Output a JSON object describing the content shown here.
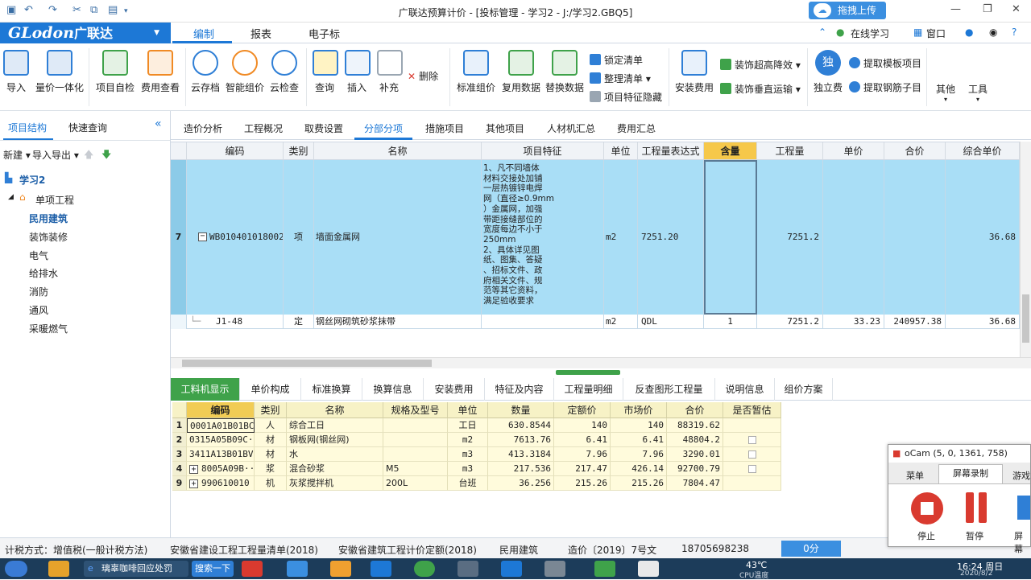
{
  "titlebar": {
    "title": "广联达预算计价 - [投标管理 - 学习2 - J:/学习2.GBQ5]",
    "upload": "拖拽上传",
    "min": "—",
    "restore": "❐",
    "close": "✕"
  },
  "menubar": {
    "logo": "GLodon",
    "logo_cn": "广联达",
    "tabs": [
      "编制",
      "报表",
      "电子标"
    ],
    "right": [
      "在线学习",
      "窗口",
      "?"
    ]
  },
  "ribbon": {
    "big": [
      "导入",
      "量价一体化",
      "项目自检",
      "费用查看",
      "云存档",
      "智能组价",
      "云检查",
      "查询",
      "插入",
      "补充",
      "标准组价",
      "复用数据",
      "替换数据",
      "安装费用",
      "独立费",
      "其他",
      "工具"
    ],
    "small": {
      "delete": "删除",
      "lock": "锁定清单",
      "tidy": "整理清单",
      "hide": "项目特征隐藏",
      "deco_height": "装饰超高降效",
      "deco_vertical": "装饰垂直运输",
      "template": "提取模板项目",
      "rebar": "提取钢筋子目"
    },
    "colors": {
      "blue": "#2f7fd6",
      "orange": "#f08a24",
      "green": "#3fa24a",
      "red": "#d93a2f"
    }
  },
  "left": {
    "tabs": [
      "项目结构",
      "快速查询"
    ],
    "toolbar": [
      "新建",
      "导入导出"
    ],
    "tree": {
      "root": "学习2",
      "unit": "单项工程",
      "items": [
        "民用建筑",
        "装饰装修",
        "电气",
        "给排水",
        "消防",
        "通风",
        "采暖燃气"
      ]
    }
  },
  "main": {
    "tabs": [
      "造价分析",
      "工程概况",
      "取费设置",
      "分部分项",
      "措施项目",
      "其他项目",
      "人材机汇总",
      "费用汇总"
    ],
    "headers": [
      "编码",
      "类别",
      "名称",
      "项目特征",
      "单位",
      "工程量表达式",
      "含量",
      "工程量",
      "单价",
      "合价",
      "综合单价"
    ],
    "row7": {
      "num": "7",
      "code": "WB010401018002",
      "type": "项",
      "name": "墙面金属网",
      "feature": [
        "1、凡不同墙体",
        "材料交接处加铺",
        "一层热镀锌电焊",
        "网（直径≥0.9mm",
        "）金属网，加强",
        "带距接缝部位的",
        "宽度每边不小于",
        "250mm",
        "2、具体详见图",
        "纸、图集、答疑",
        "、招标文件、政",
        "府相关文件、规",
        "范等其它资料，",
        "满足验收要求"
      ],
      "unit": "m2",
      "expr": "7251.20",
      "qty": "7251.2",
      "unit_price": "",
      "total": "",
      "composite": "36.68"
    },
    "sub": {
      "code": "J1-48",
      "type": "定",
      "name": "钢丝网砌筑砂浆抹带",
      "unit": "m2",
      "expr": "QDL",
      "content": "1",
      "qty": "7251.2",
      "unit_price": "33.23",
      "total": "240957.38",
      "composite": "36.68"
    }
  },
  "bottom": {
    "tabs": [
      "工料机显示",
      "单价构成",
      "标准换算",
      "换算信息",
      "安装费用",
      "特征及内容",
      "工程量明细",
      "反查图形工程量",
      "说明信息",
      "组价方案"
    ],
    "headers": [
      "编码",
      "类别",
      "名称",
      "规格及型号",
      "单位",
      "数量",
      "定额价",
      "市场价",
      "合价",
      "是否暂估"
    ],
    "rows": [
      {
        "n": "1",
        "code": "0001A01B01BC",
        "type": "人",
        "name": "综合工日",
        "spec": "",
        "unit": "工日",
        "qty": "630.8544",
        "quota": "140",
        "market": "140",
        "total": "88319.62",
        "est": ""
      },
      {
        "n": "2",
        "code": "0315A05B09C···",
        "type": "材",
        "name": "钢板网(钢丝网)",
        "spec": "",
        "unit": "m2",
        "qty": "7613.76",
        "quota": "6.41",
        "market": "6.41",
        "total": "48804.2",
        "est": "box"
      },
      {
        "n": "3",
        "code": "3411A13B01BV",
        "type": "材",
        "name": "水",
        "spec": "",
        "unit": "m3",
        "qty": "413.3184",
        "quota": "7.96",
        "market": "7.96",
        "total": "3290.01",
        "est": "box"
      },
      {
        "n": "4",
        "code": "8005A09B···",
        "type": "浆",
        "name": "混合砂浆",
        "spec": "M5",
        "unit": "m3",
        "qty": "217.536",
        "quota": "217.47",
        "market": "426.14",
        "total": "92700.79",
        "est": "box"
      },
      {
        "n": "9",
        "code": "990610010",
        "type": "机",
        "name": "灰浆搅拌机",
        "spec": "200L",
        "unit": "台班",
        "qty": "36.256",
        "quota": "215.26",
        "market": "215.26",
        "total": "7804.47",
        "est": ""
      }
    ]
  },
  "status": [
    "计税方式：增值税(一般计税方法)",
    "安徽省建设工程工程量清单(2018)",
    "安徽省建筑工程计价定额(2018)",
    "民用建筑",
    "造价〔2019〕7号文",
    "18705698238",
    "0分"
  ],
  "ocam": {
    "title": "oCam (5, 0, 1361, 758)",
    "tabs": [
      "菜单",
      "屏幕录制",
      "游戏"
    ],
    "buttons": [
      "停止",
      "暂停",
      "屏幕"
    ]
  },
  "taskbar": {
    "items": [
      "璃辜咖啡回应处罚",
      "搜索一下"
    ],
    "temp": "43℃",
    "cpu": "CPU温度",
    "time": "16:24 周日",
    "date": "2020/8/2"
  }
}
